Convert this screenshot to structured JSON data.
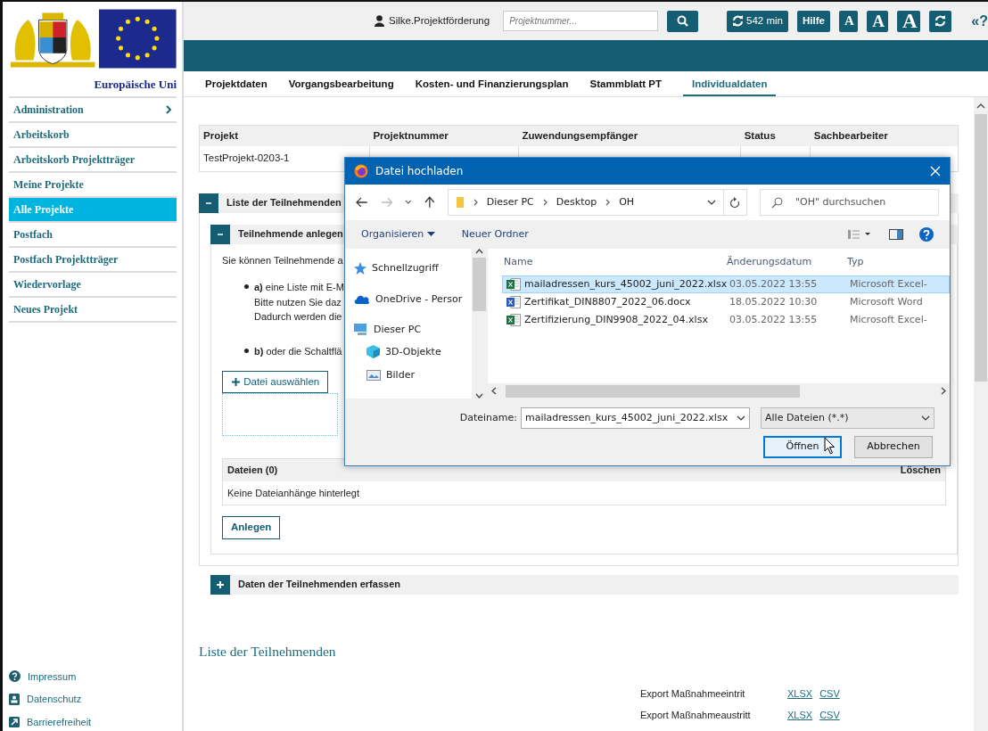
{
  "sidebar": {
    "logo_caption": "Europäische Uni",
    "items": [
      {
        "label": "Administration",
        "selected": false,
        "has_submenu": true
      },
      {
        "label": "Arbeitskorb",
        "selected": false,
        "has_submenu": false
      },
      {
        "label": "Arbeitskorb Projektträger",
        "selected": false,
        "has_submenu": false
      },
      {
        "label": "Meine Projekte",
        "selected": false,
        "has_submenu": false
      },
      {
        "label": "Alle Projekte",
        "selected": true,
        "has_submenu": false
      },
      {
        "label": "Postfach",
        "selected": false,
        "has_submenu": false
      },
      {
        "label": "Postfach Projektträger",
        "selected": false,
        "has_submenu": false
      },
      {
        "label": "Wiedervorlage",
        "selected": false,
        "has_submenu": false
      },
      {
        "label": "Neues Projekt",
        "selected": false,
        "has_submenu": false
      }
    ],
    "footer_links": [
      {
        "label": "Impressum",
        "kind": "help"
      },
      {
        "label": "Datenschutz",
        "kind": "contact"
      },
      {
        "label": "Barrierefreiheit",
        "kind": "external"
      }
    ]
  },
  "topbar": {
    "user": "Silke.Projektförderung",
    "search": {
      "placeholder": "Projektnummer..."
    },
    "session_timer": "542 min",
    "help": "Hilfe",
    "font_sizes": [
      "A",
      "A",
      "A"
    ],
    "collapse": "«?"
  },
  "tabs": [
    {
      "label": "Projektdaten",
      "selected": false
    },
    {
      "label": "Vorgangsbearbeitung",
      "selected": false
    },
    {
      "label": "Kosten- und Finanzierungsplan",
      "selected": false
    },
    {
      "label": "Stammblatt PT",
      "selected": false
    },
    {
      "label": "Individualdaten",
      "selected": true
    }
  ],
  "project_table": {
    "columns": [
      "Projekt",
      "Projektnummer",
      "Zuwendungsempfänger",
      "Status",
      "Sachbearbeiter"
    ],
    "rows": [
      [
        "TestProjekt-0203-1"
      ]
    ]
  },
  "section": {
    "title": "Liste der Teilnehmenden",
    "expanded": true,
    "subsection": {
      "title": "Teilnehmende anlegen",
      "expanded": true,
      "intro": "Sie können Teilnehmende a",
      "bullets": [
        {
          "text": "**a)** eine Liste mit E-M",
          "more": [
            "Bitte nutzen Sie daz",
            "Dadurch werden die"
          ]
        },
        {
          "text": "**b)** oder die Schaltflä"
        }
      ],
      "choose_button": "Datei auswählen",
      "files_table": {
        "title": "Dateien (0)",
        "column_2": "Löschen",
        "empty": "Keine Dateianhänge hinterlegt"
      },
      "create_button": "Anlegen"
    }
  },
  "collapsed_section": {
    "title": "Daten der Teilnehmenden erfassen",
    "expanded": false
  },
  "list_heading": "Liste der Teilnehmenden",
  "exports": [
    {
      "label": "Export Maßnahmeeintrit",
      "links": [
        "XLSX",
        "CSV"
      ]
    },
    {
      "label": "Export Maßnahmeaustritt",
      "links": [
        "XLSX",
        "CSV"
      ]
    }
  ],
  "dialog": {
    "title": "Datei hochladen",
    "breadcrumb": [
      "Dieser PC",
      "Desktop",
      "OH"
    ],
    "search": {
      "placeholder": "\"OH\" durchsuchen"
    },
    "toolbar": [
      "Organisieren",
      "Neuer Ordner"
    ],
    "nav": [
      {
        "label": "Schnellzugriff",
        "kind": "star"
      },
      {
        "label": "OneDrive - Persor",
        "kind": "cloud"
      },
      {
        "label": "Dieser PC",
        "kind": "pc",
        "children": [
          {
            "label": "3D-Objekte",
            "kind": "cube"
          },
          {
            "label": "Bilder",
            "kind": "pictures"
          }
        ]
      }
    ],
    "columns": [
      "Name",
      "Änderungsdatum",
      "Typ"
    ],
    "files": [
      {
        "name": "mailadressen_kurs_45002_juni_2022.xlsx",
        "date": "03.05.2022 13:55",
        "type": "Microsoft Excel-",
        "kind": "excel",
        "selected": true
      },
      {
        "name": "Zertifikat_DIN8807_2022_06.docx",
        "date": "18.05.2022 10:30",
        "type": "Microsoft Word",
        "kind": "word",
        "selected": false
      },
      {
        "name": "Zertifizierung_DIN9908_2022_04.xlsx",
        "date": "03.05.2022 13:55",
        "type": "Microsoft Excel-",
        "kind": "excel",
        "selected": false
      }
    ],
    "filename_label": "Dateiname:",
    "filename": "mailadressen_kurs_45002_juni_2022.xlsx",
    "filter": "Alle Dateien (*.*)",
    "buttons": [
      {
        "label": "Öffnen",
        "kind": "primary"
      },
      {
        "label": "Abbrechen",
        "kind": "secondary"
      }
    ]
  }
}
